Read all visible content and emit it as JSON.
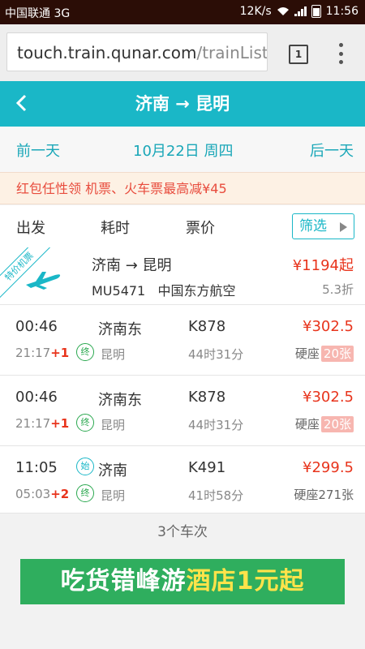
{
  "status_bar": {
    "carrier": "中国联通 3G",
    "speed": "12K/s",
    "time": "11:56"
  },
  "browser": {
    "url_host": "touch.train.qunar.com",
    "url_path": "/trainList",
    "tab_count": "1"
  },
  "header": {
    "title": "济南 → 昆明"
  },
  "date_bar": {
    "prev": "前一天",
    "current": "10月22日 周四",
    "next": "后一天"
  },
  "promo": {
    "text": "红包任性领 机票、火车票最高减¥45"
  },
  "sort_bar": {
    "depart": "出发",
    "duration": "耗时",
    "price": "票价",
    "filter": "筛选"
  },
  "flight": {
    "ribbon": "特价机票",
    "route": "济南 → 昆明",
    "flight_no": "MU5471",
    "airline": "中国东方航空",
    "price": "¥1194起",
    "discount": "5.3折"
  },
  "trains": [
    {
      "depart_time": "00:46",
      "arrive_time": "21:17",
      "day_offset": "+1",
      "from": "济南东",
      "to": "昆明",
      "start_tag": "",
      "end_tag": "终",
      "train_no": "K878",
      "duration": "44时31分",
      "price": "¥302.5",
      "seat_type": "硬座",
      "seat_count": "20张"
    },
    {
      "depart_time": "00:46",
      "arrive_time": "21:17",
      "day_offset": "+1",
      "from": "济南东",
      "to": "昆明",
      "start_tag": "",
      "end_tag": "终",
      "train_no": "K878",
      "duration": "44时31分",
      "price": "¥302.5",
      "seat_type": "硬座",
      "seat_count": "20张"
    },
    {
      "depart_time": "11:05",
      "arrive_time": "05:03",
      "day_offset": "+2",
      "from": "济南",
      "to": "昆明",
      "start_tag": "始",
      "end_tag": "终",
      "train_no": "K491",
      "duration": "41时58分",
      "price": "¥299.5",
      "seat_type": "硬座",
      "seat_count": "271张"
    }
  ],
  "footer": {
    "count_text": "3个车次"
  },
  "banner": {
    "part1": "吃货",
    "part2": "错峰游",
    "part3": "酒店",
    "part4": "1",
    "part5": "元起"
  },
  "colors": {
    "accent": "#1ab7c7",
    "price": "#e8341c",
    "promo_bg": "#fdf1e4"
  }
}
